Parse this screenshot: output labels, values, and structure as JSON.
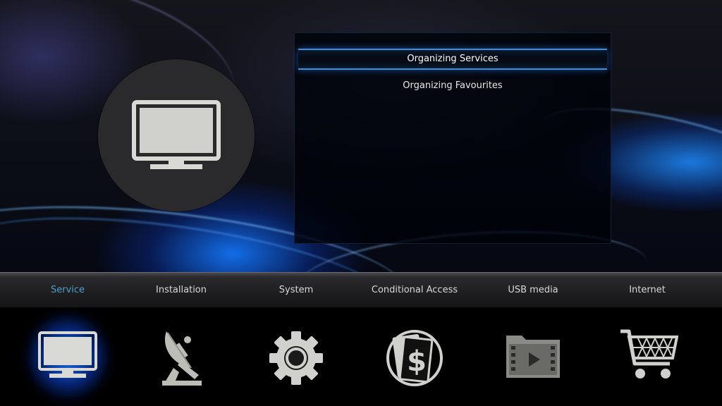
{
  "screen": {
    "hero_icon": "tv-icon",
    "accent_color": "#3a8fe0",
    "active_tab_color": "#4aa0c8"
  },
  "submenu": {
    "items": [
      {
        "label": "Organizing Services",
        "selected": true
      },
      {
        "label": "Organizing Favourites",
        "selected": false
      }
    ]
  },
  "tabs": [
    {
      "label": "Service",
      "icon": "tv-icon",
      "active": true
    },
    {
      "label": "Installation",
      "icon": "satellite-dish-icon",
      "active": false
    },
    {
      "label": "System",
      "icon": "gear-icon",
      "active": false
    },
    {
      "label": "Conditional Access",
      "icon": "dollar-cards-icon",
      "active": false
    },
    {
      "label": "USB media",
      "icon": "video-folder-icon",
      "active": false
    },
    {
      "label": "Internet",
      "icon": "shopping-cart-icon",
      "active": false
    }
  ]
}
